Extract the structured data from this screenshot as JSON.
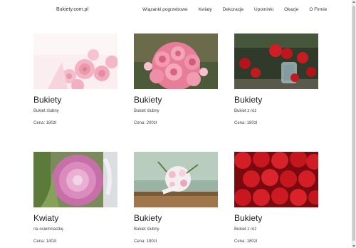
{
  "nav": {
    "brand": "Bukiety.com.pl",
    "links": [
      "Wiązanki pogrzebowe",
      "Kwiaty",
      "Dekoracje",
      "Upominki",
      "Okazje",
      "O Firmie"
    ]
  },
  "products": [
    {
      "title": "Bukiety",
      "description": "Bukiet ślubny",
      "price": "Cena: 180zł",
      "image": "pink-roses-bouquet"
    },
    {
      "title": "Bukiety",
      "description": "Bukiet ślubny",
      "price": "Cena: 200zł",
      "image": "pink-roses-bouquet-dark"
    },
    {
      "title": "Bukiety",
      "description": "Bukiet z róż",
      "price": "Cena: 180zł",
      "image": "red-roses-in-vase"
    },
    {
      "title": "Kwiaty",
      "description": "na osiemnastkę",
      "price": "Cena: 140zł",
      "image": "pink-cabbage-flower"
    },
    {
      "title": "Bukiety",
      "description": "Bukiet ślubny",
      "price": "Cena: 180zł",
      "image": "white-pink-wedding-bouquet"
    },
    {
      "title": "Bukiety",
      "description": "Bukiet z róż",
      "price": "Cena: 180zł",
      "image": "red-roses"
    }
  ],
  "colors": {
    "pink_light": "#f3b3c3",
    "pink_dark": "#e26f8e",
    "red": "#d41e25",
    "leaf_green": "#6c8f3a"
  }
}
